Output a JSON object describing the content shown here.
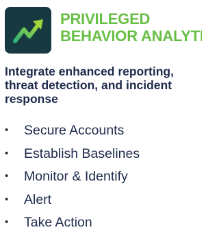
{
  "header": {
    "title_line1": "PRIVILEGED",
    "title_line2": "BEHAVIOR ANALYTICS",
    "logo_icon": "trend-up-arrow-icon",
    "colors": {
      "logo_bg": "#173a40",
      "accent": "#68bf45",
      "text": "#1d2a4a"
    }
  },
  "description": {
    "line1": "Integrate enhanced reporting,",
    "line2": "threat detection, and incident",
    "line3": "response"
  },
  "steps": [
    {
      "bullet": "•",
      "label": "Secure Accounts"
    },
    {
      "bullet": "•",
      "label": "Establish Baselines"
    },
    {
      "bullet": "•",
      "label": "Monitor & Identify"
    },
    {
      "bullet": "•",
      "label": "Alert"
    },
    {
      "bullet": "•",
      "label": "Take Action"
    }
  ]
}
